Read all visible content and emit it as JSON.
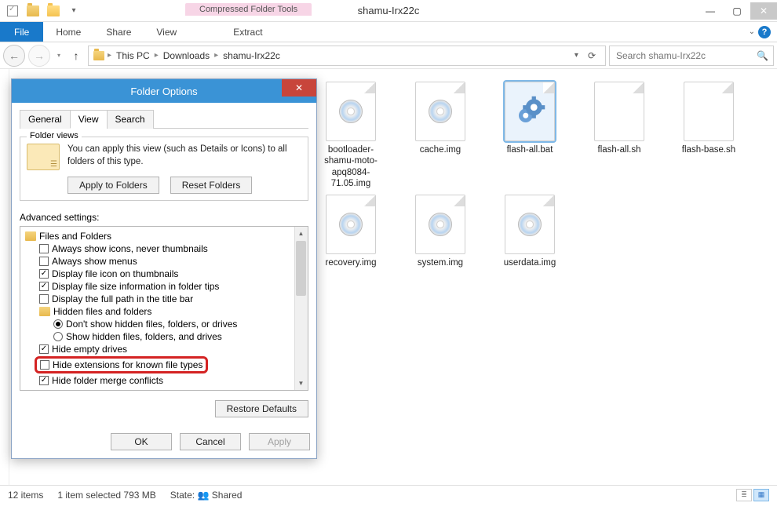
{
  "window": {
    "title": "shamu-Irx22c",
    "contextTab": "Compressed Folder Tools"
  },
  "ribbon": {
    "file": "File",
    "home": "Home",
    "share": "Share",
    "view": "View",
    "extract": "Extract"
  },
  "breadcrumb": {
    "root": "This PC",
    "l1": "Downloads",
    "l2": "shamu-Irx22c"
  },
  "search": {
    "placeholder": "Search shamu-Irx22c"
  },
  "files": {
    "f0": "bootloader-shamu-moto-apq8084-71.05.img",
    "f1": "cache.img",
    "f2": "flash-all.bat",
    "f3": "flash-all.sh",
    "f4": "flash-base.sh",
    "f5": "recovery.img",
    "f6": "system.img",
    "f7": "userdata.img"
  },
  "status": {
    "items": "12 items",
    "selected": "1 item selected  793 MB",
    "stateLabel": "State:",
    "state": "Shared"
  },
  "dialog": {
    "title": "Folder Options",
    "tabs": {
      "general": "General",
      "view": "View",
      "search": "Search"
    },
    "folderViews": {
      "legend": "Folder views",
      "text": "You can apply this view (such as Details or Icons) to all folders of this type.",
      "apply": "Apply to Folders",
      "reset": "Reset Folders"
    },
    "advLabel": "Advanced settings:",
    "adv": {
      "root": "Files and Folders",
      "a": "Always show icons, never thumbnails",
      "b": "Always show menus",
      "c": "Display file icon on thumbnails",
      "d": "Display file size information in folder tips",
      "e": "Display the full path in the title bar",
      "f": "Hidden files and folders",
      "g": "Don't show hidden files, folders, or drives",
      "h": "Show hidden files, folders, and drives",
      "i": "Hide empty drives",
      "j": "Hide extensions for known file types",
      "k": "Hide folder merge conflicts"
    },
    "restore": "Restore Defaults",
    "ok": "OK",
    "cancel": "Cancel",
    "applyBtn": "Apply"
  }
}
